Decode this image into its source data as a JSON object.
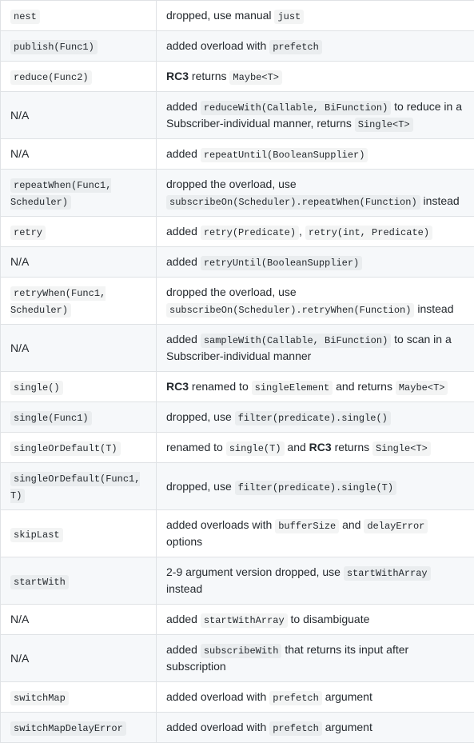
{
  "rows": [
    {
      "left": [
        {
          "t": "code",
          "v": "nest"
        }
      ],
      "right": [
        {
          "t": "text",
          "v": "dropped, use manual "
        },
        {
          "t": "code",
          "v": "just"
        }
      ]
    },
    {
      "left": [
        {
          "t": "code",
          "v": "publish(Func1)"
        }
      ],
      "right": [
        {
          "t": "text",
          "v": "added overload with "
        },
        {
          "t": "code",
          "v": "prefetch"
        }
      ]
    },
    {
      "left": [
        {
          "t": "code",
          "v": "reduce(Func2)"
        }
      ],
      "right": [
        {
          "t": "strong",
          "v": "RC3"
        },
        {
          "t": "text",
          "v": " returns "
        },
        {
          "t": "code",
          "v": "Maybe<T>"
        }
      ]
    },
    {
      "left": [
        {
          "t": "text",
          "v": "N/A"
        }
      ],
      "right": [
        {
          "t": "text",
          "v": "added "
        },
        {
          "t": "code",
          "v": "reduceWith(Callable, BiFunction)"
        },
        {
          "t": "text",
          "v": " to reduce in a Subscriber-individual manner, returns "
        },
        {
          "t": "code",
          "v": "Single<T>"
        }
      ]
    },
    {
      "left": [
        {
          "t": "text",
          "v": "N/A"
        }
      ],
      "right": [
        {
          "t": "text",
          "v": "added "
        },
        {
          "t": "code",
          "v": "repeatUntil(BooleanSupplier)"
        }
      ]
    },
    {
      "left": [
        {
          "t": "code",
          "v": "repeatWhen(Func1, Scheduler)"
        }
      ],
      "right": [
        {
          "t": "text",
          "v": "dropped the overload, use "
        },
        {
          "t": "code",
          "v": "subscribeOn(Scheduler).repeatWhen(Function)"
        },
        {
          "t": "text",
          "v": " instead"
        }
      ]
    },
    {
      "left": [
        {
          "t": "code",
          "v": "retry"
        }
      ],
      "right": [
        {
          "t": "text",
          "v": "added "
        },
        {
          "t": "code",
          "v": "retry(Predicate)"
        },
        {
          "t": "text",
          "v": ", "
        },
        {
          "t": "code",
          "v": "retry(int, Predicate)"
        }
      ]
    },
    {
      "left": [
        {
          "t": "text",
          "v": "N/A"
        }
      ],
      "right": [
        {
          "t": "text",
          "v": "added "
        },
        {
          "t": "code",
          "v": "retryUntil(BooleanSupplier)"
        }
      ]
    },
    {
      "left": [
        {
          "t": "code",
          "v": "retryWhen(Func1, Scheduler)"
        }
      ],
      "right": [
        {
          "t": "text",
          "v": "dropped the overload, use "
        },
        {
          "t": "code",
          "v": "subscribeOn(Scheduler).retryWhen(Function)"
        },
        {
          "t": "text",
          "v": " instead"
        }
      ]
    },
    {
      "left": [
        {
          "t": "text",
          "v": "N/A"
        }
      ],
      "right": [
        {
          "t": "text",
          "v": "added "
        },
        {
          "t": "code",
          "v": "sampleWith(Callable, BiFunction)"
        },
        {
          "t": "text",
          "v": " to scan in a Subscriber-individual manner"
        }
      ]
    },
    {
      "left": [
        {
          "t": "code",
          "v": "single()"
        }
      ],
      "right": [
        {
          "t": "strong",
          "v": "RC3"
        },
        {
          "t": "text",
          "v": " renamed to "
        },
        {
          "t": "code",
          "v": "singleElement"
        },
        {
          "t": "text",
          "v": " and returns "
        },
        {
          "t": "code",
          "v": "Maybe<T>"
        }
      ]
    },
    {
      "left": [
        {
          "t": "code",
          "v": "single(Func1)"
        }
      ],
      "right": [
        {
          "t": "text",
          "v": "dropped, use "
        },
        {
          "t": "code",
          "v": "filter(predicate).single()"
        }
      ]
    },
    {
      "left": [
        {
          "t": "code",
          "v": "singleOrDefault(T)"
        }
      ],
      "right": [
        {
          "t": "text",
          "v": "renamed to "
        },
        {
          "t": "code",
          "v": "single(T)"
        },
        {
          "t": "text",
          "v": " and "
        },
        {
          "t": "strong",
          "v": "RC3"
        },
        {
          "t": "text",
          "v": " returns "
        },
        {
          "t": "code",
          "v": "Single<T>"
        }
      ]
    },
    {
      "left": [
        {
          "t": "code",
          "v": "singleOrDefault(Func1, T)"
        }
      ],
      "right": [
        {
          "t": "text",
          "v": "dropped, use "
        },
        {
          "t": "code",
          "v": "filter(predicate).single(T)"
        }
      ]
    },
    {
      "left": [
        {
          "t": "code",
          "v": "skipLast"
        }
      ],
      "right": [
        {
          "t": "text",
          "v": "added overloads with "
        },
        {
          "t": "code",
          "v": "bufferSize"
        },
        {
          "t": "text",
          "v": " and "
        },
        {
          "t": "code",
          "v": "delayError"
        },
        {
          "t": "text",
          "v": " options"
        }
      ]
    },
    {
      "left": [
        {
          "t": "code",
          "v": "startWith"
        }
      ],
      "right": [
        {
          "t": "text",
          "v": "2-9 argument version dropped, use "
        },
        {
          "t": "code",
          "v": "startWithArray"
        },
        {
          "t": "text",
          "v": " instead"
        }
      ]
    },
    {
      "left": [
        {
          "t": "text",
          "v": "N/A"
        }
      ],
      "right": [
        {
          "t": "text",
          "v": "added "
        },
        {
          "t": "code",
          "v": "startWithArray"
        },
        {
          "t": "text",
          "v": " to disambiguate"
        }
      ]
    },
    {
      "left": [
        {
          "t": "text",
          "v": "N/A"
        }
      ],
      "right": [
        {
          "t": "text",
          "v": "added "
        },
        {
          "t": "code",
          "v": "subscribeWith"
        },
        {
          "t": "text",
          "v": " that returns its input after subscription"
        }
      ]
    },
    {
      "left": [
        {
          "t": "code",
          "v": "switchMap"
        }
      ],
      "right": [
        {
          "t": "text",
          "v": "added overload with "
        },
        {
          "t": "code",
          "v": "prefetch"
        },
        {
          "t": "text",
          "v": " argument"
        }
      ]
    },
    {
      "left": [
        {
          "t": "code",
          "v": "switchMapDelayError"
        }
      ],
      "right": [
        {
          "t": "text",
          "v": "added overload with "
        },
        {
          "t": "code",
          "v": "prefetch"
        },
        {
          "t": "text",
          "v": " argument"
        }
      ]
    }
  ]
}
